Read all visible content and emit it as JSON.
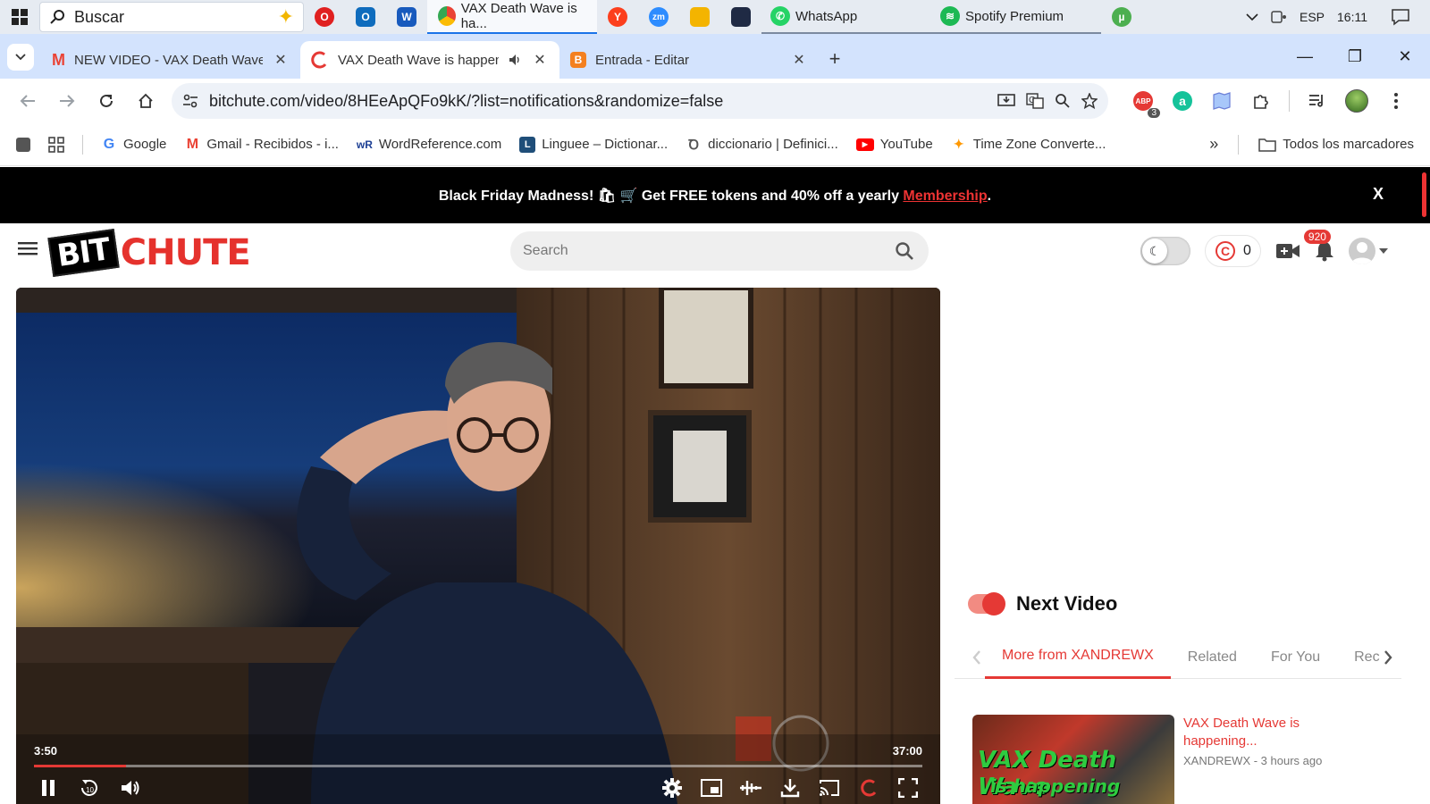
{
  "taskbar": {
    "search_text": "Buscar",
    "apps": [
      {
        "name": "opera",
        "color": "#e02020",
        "glyph": "O"
      },
      {
        "name": "outlook",
        "color": "#0f6cbd",
        "glyph": "O"
      },
      {
        "name": "word",
        "color": "#185abd",
        "glyph": "W"
      }
    ],
    "chrome_label": "VAX Death Wave is ha...",
    "apps2": [
      {
        "name": "yandex",
        "color": "#fc3f1d",
        "glyph": "Y"
      },
      {
        "name": "zoom",
        "color": "#2d8cff",
        "glyph": "zm"
      },
      {
        "name": "explorer",
        "color": "#f4b400",
        "glyph": ""
      },
      {
        "name": "shield",
        "color": "#1f2a44",
        "glyph": ""
      }
    ],
    "whatsapp_label": "WhatsApp",
    "spotify_label": "Spotify Premium",
    "lang": "ESP",
    "clock": "16:11"
  },
  "tabs": [
    {
      "title": "NEW VIDEO - VAX Death Wave",
      "icon_color": "#ea4335",
      "icon_glyph": "M",
      "active": false
    },
    {
      "title": "VAX Death Wave is happeni",
      "icon_color": "#e53935",
      "icon_glyph": "C",
      "active": true
    },
    {
      "title": "Entrada - Editar",
      "icon_color": "#f4801f",
      "icon_glyph": "B",
      "active": false
    }
  ],
  "omnibox": {
    "url": "bitchute.com/video/8HEeApQFo9kK/?list=notifications&randomize=false"
  },
  "extensions": {
    "badge": "3"
  },
  "bookmarks": [
    {
      "label": "Google",
      "glyph": "G",
      "color": "#4285f4"
    },
    {
      "label": "Gmail - Recibidos - i...",
      "glyph": "M",
      "color": "#ea4335"
    },
    {
      "label": "WordReference.com",
      "glyph": "wR",
      "color": "#1c3f94"
    },
    {
      "label": "Linguee – Dictionar...",
      "glyph": "L",
      "color": "#1f4e79"
    },
    {
      "label": "diccionario | Definici...",
      "glyph": "D",
      "color": "#555555"
    },
    {
      "label": "YouTube",
      "glyph": "▶",
      "color": "#ff0000"
    },
    {
      "label": "Time Zone Converte...",
      "glyph": "✦",
      "color": "#ff9800"
    }
  ],
  "bookmarks_all": "Todos los marcadores",
  "promo": {
    "part1": "Black Friday Madness! 🛍 🛒 Get ",
    "bold1": "FREE tokens",
    "part2": " and ",
    "bold2": "40% off",
    "part3": " a yearly ",
    "link": "Membership",
    "end": ".",
    "close": "X"
  },
  "site": {
    "logo_bit": "BIT",
    "logo_chute": "CHUTE",
    "search_placeholder": "Search",
    "tokens": "0",
    "notifications": "920"
  },
  "player": {
    "current": "3:50",
    "duration": "37:00",
    "progress": 0.104,
    "rewind_label": "10"
  },
  "sidebar": {
    "next_video_label": "Next Video",
    "autoplay_on": true,
    "tabs": [
      "More from XANDREWX",
      "Related",
      "For You",
      "Rec"
    ],
    "card": {
      "title": "VAX Death Wave is happening...",
      "meta": "XANDREWX - 3 hours ago",
      "thumb_line1": "VAX Death Wave",
      "thumb_line2": "is happening"
    }
  }
}
